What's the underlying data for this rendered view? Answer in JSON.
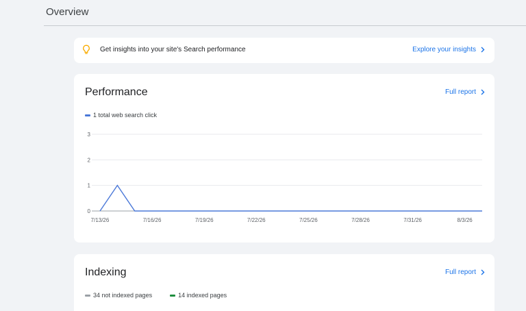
{
  "header": {
    "title": "Overview"
  },
  "insight": {
    "text": "Get insights into your site's Search performance",
    "link_label": "Explore your insights"
  },
  "performance": {
    "title": "Performance",
    "link_label": "Full report",
    "legend_label": "1 total web search click",
    "series_color": "#4a78d8"
  },
  "indexing": {
    "title": "Indexing",
    "link_label": "Full report",
    "legend": [
      {
        "label": "34 not indexed pages",
        "color": "#9aa0a6"
      },
      {
        "label": "14 indexed pages",
        "color": "#1e8e3e"
      }
    ]
  },
  "chart_data": {
    "type": "line",
    "x": [
      "7/13/26",
      "7/14/26",
      "7/15/26",
      "7/16/26",
      "7/17/26",
      "7/18/26",
      "7/19/26",
      "7/20/26",
      "7/21/26",
      "7/22/26",
      "7/23/26",
      "7/24/26",
      "7/25/26",
      "7/26/26",
      "7/27/26",
      "7/28/26",
      "7/29/26",
      "7/30/26",
      "7/31/26",
      "8/1/26",
      "8/2/26",
      "8/3/26",
      "8/4/26"
    ],
    "series": [
      {
        "name": "",
        "values": [
          0,
          1,
          0,
          0,
          0,
          0,
          0,
          0,
          0,
          0,
          0,
          0,
          0,
          0,
          0,
          0,
          0,
          0,
          0,
          0,
          0,
          0,
          0
        ]
      }
    ],
    "x_tick_labels": [
      "7/13/26",
      "7/16/26",
      "7/19/26",
      "7/22/26",
      "7/25/26",
      "7/28/26",
      "7/31/26",
      "8/3/26"
    ],
    "y_tick_labels": [
      "0",
      "1",
      "2",
      "3"
    ],
    "ylim": [
      0,
      3
    ],
    "grid": true,
    "title": "",
    "xlabel": "",
    "ylabel": ""
  }
}
